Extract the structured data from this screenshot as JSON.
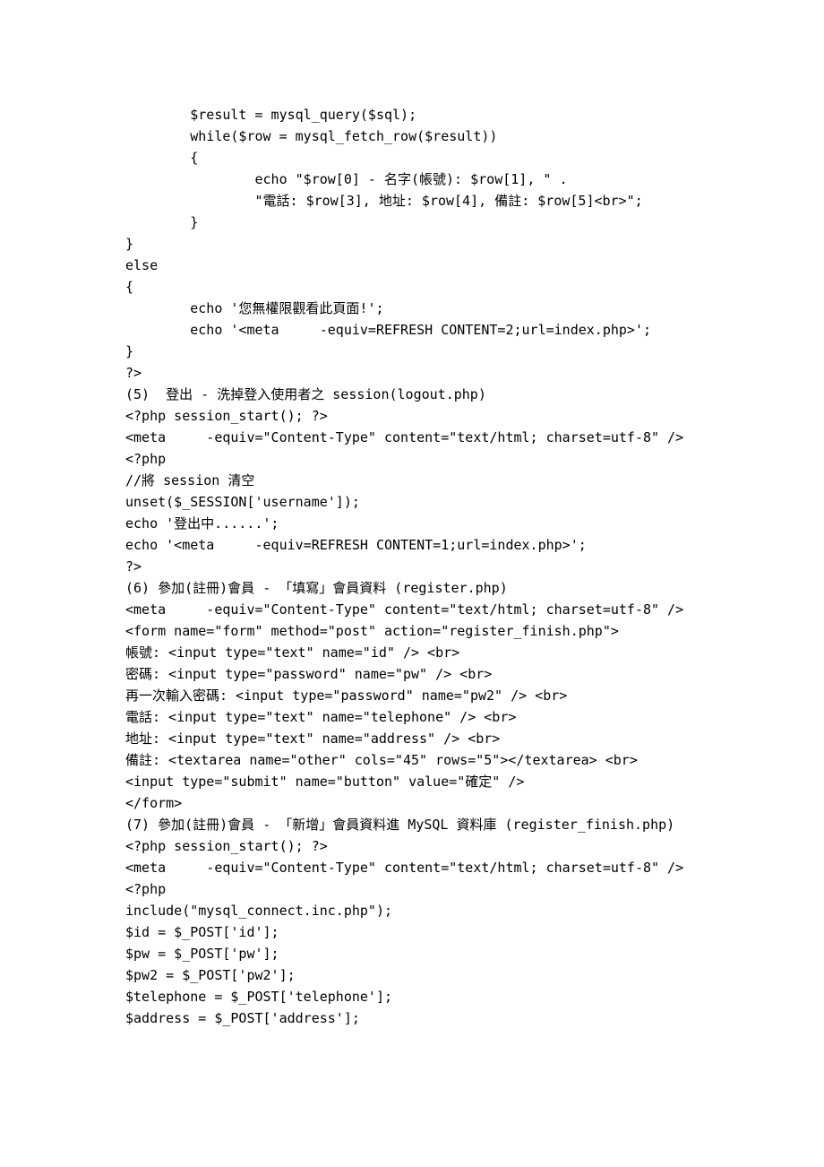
{
  "lines": [
    "        $result = mysql_query($sql);",
    "        while($row = mysql_fetch_row($result))",
    "        {",
    "                echo \"$row[0] - 名字(帳號): $row[1], \" .",
    "                \"電話: $row[3], 地址: $row[4], 備註: $row[5]<br>\";",
    "        }",
    "}",
    "else",
    "{",
    "        echo '您無權限觀看此頁面!';",
    "        echo '<meta     -equiv=REFRESH CONTENT=2;url=index.php>';",
    "}",
    "?>",
    "(5)  登出 - 洗掉登入使用者之 session(logout.php)",
    "<?php session_start(); ?>",
    "<meta     -equiv=\"Content-Type\" content=\"text/html; charset=utf-8\" />",
    "<?php",
    "//將 session 清空",
    "unset($_SESSION['username']);",
    "echo '登出中......';",
    "echo '<meta     -equiv=REFRESH CONTENT=1;url=index.php>';",
    "?>",
    "(6) 參加(註冊)會員 - 「填寫」會員資料 (register.php)",
    "<meta     -equiv=\"Content-Type\" content=\"text/html; charset=utf-8\" />",
    "<form name=\"form\" method=\"post\" action=\"register_finish.php\">",
    "帳號: <input type=\"text\" name=\"id\" /> <br>",
    "密碼: <input type=\"password\" name=\"pw\" /> <br>",
    "再一次輸入密碼: <input type=\"password\" name=\"pw2\" /> <br>",
    "電話: <input type=\"text\" name=\"telephone\" /> <br>",
    "地址: <input type=\"text\" name=\"address\" /> <br>",
    "備註: <textarea name=\"other\" cols=\"45\" rows=\"5\"></textarea> <br>",
    "<input type=\"submit\" name=\"button\" value=\"確定\" />",
    "</form>",
    "(7) 參加(註冊)會員 - 「新增」會員資料進 MySQL 資料庫 (register_finish.php)",
    "<?php session_start(); ?>",
    "<meta     -equiv=\"Content-Type\" content=\"text/html; charset=utf-8\" />",
    "<?php",
    "include(\"mysql_connect.inc.php\");",
    "",
    "$id = $_POST['id'];",
    "$pw = $_POST['pw'];",
    "$pw2 = $_POST['pw2'];",
    "$telephone = $_POST['telephone'];",
    "$address = $_POST['address'];"
  ]
}
